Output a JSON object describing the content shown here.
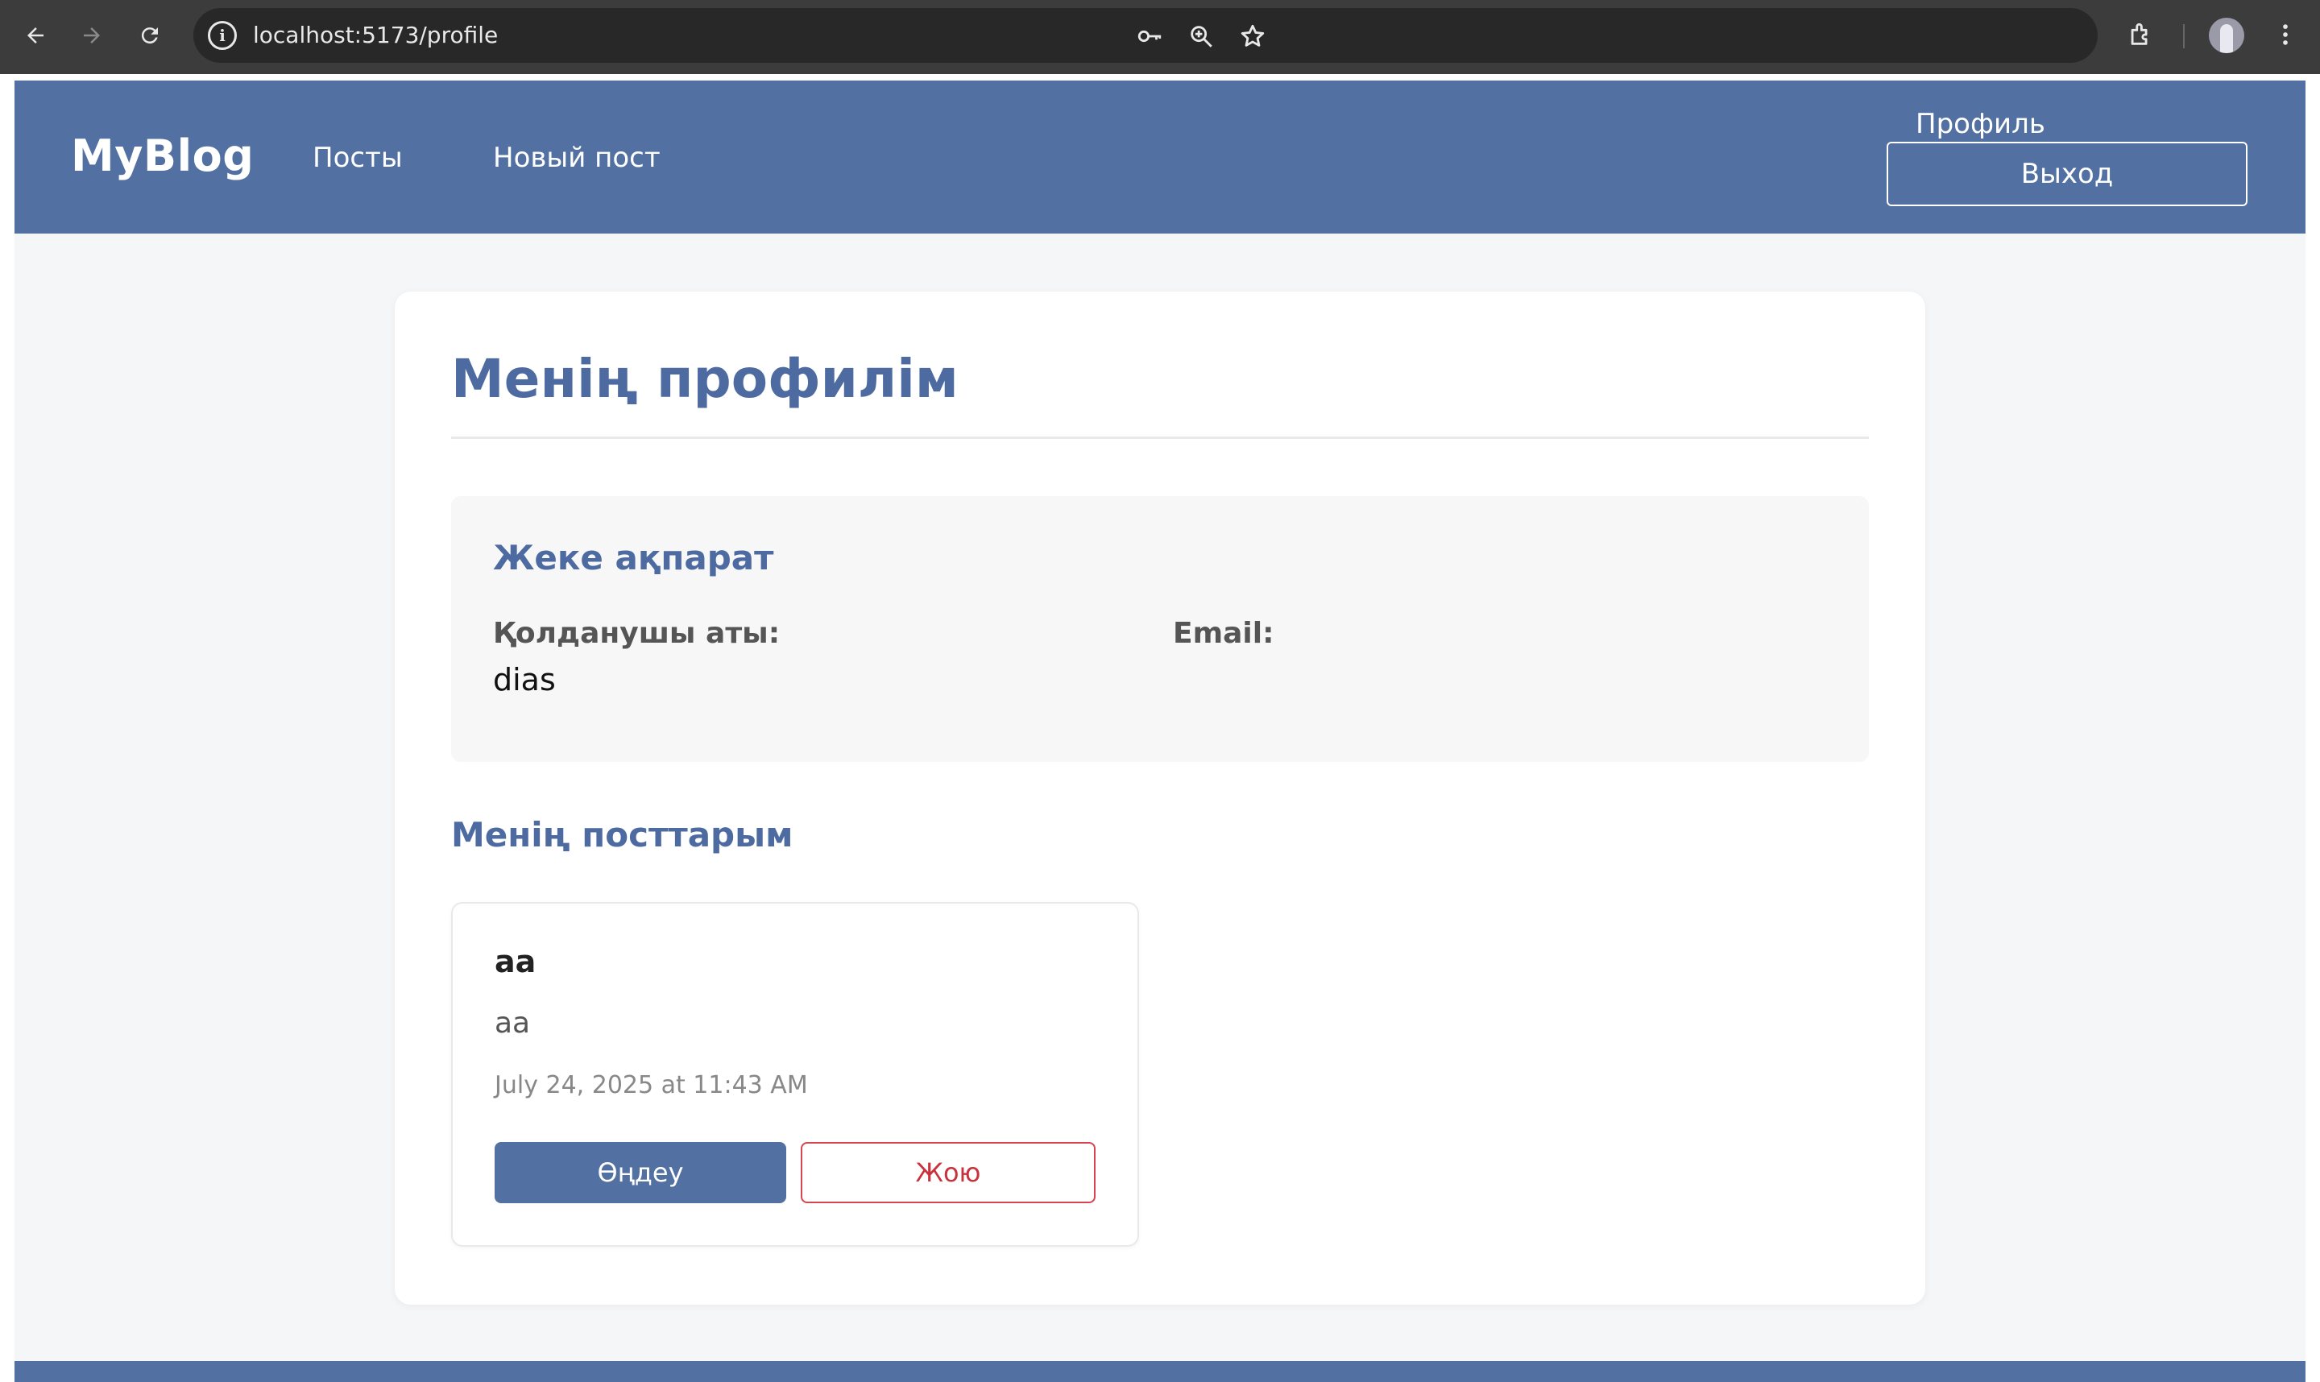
{
  "browser": {
    "url": "localhost:5173/profile",
    "icons": [
      "back-arrow-icon",
      "forward-arrow-icon",
      "reload-icon",
      "site-info-icon",
      "password-key-icon",
      "zoom-icon",
      "bookmark-star-icon",
      "extensions-icon",
      "profile-avatar",
      "menu-dots-icon"
    ]
  },
  "header": {
    "brand": "MyBlog",
    "nav": [
      "Посты",
      "Новый пост"
    ],
    "profile_link": "Профиль",
    "logout_label": "Выход"
  },
  "profile": {
    "title": "Менің профилім",
    "info_section": {
      "title": "Жеке ақпарат",
      "username_label": "Қолданушы аты:",
      "username_value": "dias",
      "email_label": "Email:",
      "email_value": ""
    }
  },
  "posts": {
    "title": "Менің посттарым",
    "items": [
      {
        "title": "aa",
        "body": "aa",
        "date": "July 24, 2025 at 11:43 AM",
        "edit_label": "Өңдеу",
        "delete_label": "Жою"
      }
    ]
  },
  "colors": {
    "primary": "#5270a1",
    "heading": "#4d6aa1",
    "danger": "#c8323c",
    "page_bg": "#f5f6f8"
  }
}
